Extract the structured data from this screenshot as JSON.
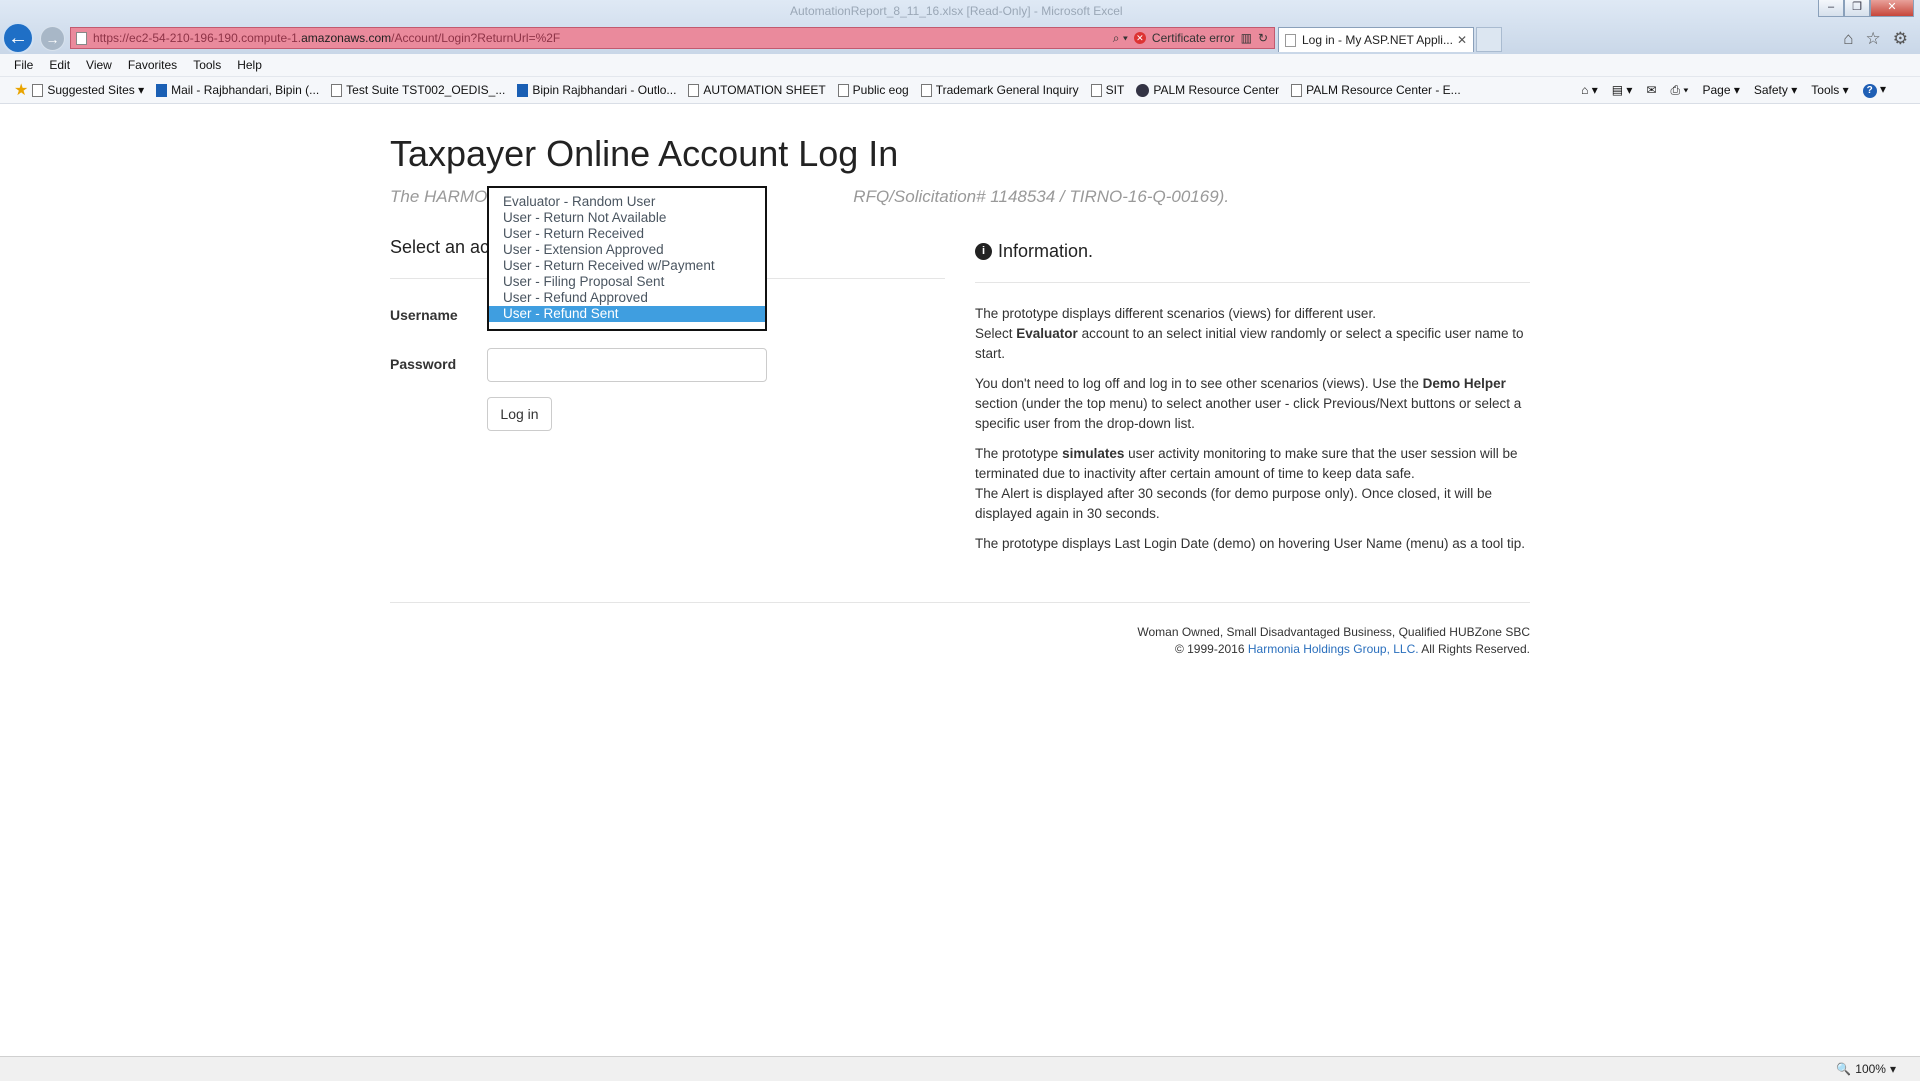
{
  "browser": {
    "window_title": "AutomationReport_8_11_16.xlsx [Read-Only] - Microsoft Excel",
    "url_prefix": "https://ec2-54-210-196-190.compute-1.",
    "url_domain": "amazonaws.com",
    "url_suffix": "/Account/Login?ReturnUrl=%2F",
    "certificate_error": "Certificate error",
    "tab_title": "Log in - My ASP.NET Appli...",
    "menu": [
      "File",
      "Edit",
      "View",
      "Favorites",
      "Tools",
      "Help"
    ],
    "favorites": [
      {
        "label": "Suggested Sites ▾",
        "icon": "page-icon"
      },
      {
        "label": "Mail - Rajbhandari, Bipin (...",
        "icon": "outlook-icon"
      },
      {
        "label": "Test Suite TST002_OEDIS_...",
        "icon": "page-icon"
      },
      {
        "label": "Bipin Rajbhandari - Outlo...",
        "icon": "outlook-icon"
      },
      {
        "label": "AUTOMATION SHEET",
        "icon": "page-icon"
      },
      {
        "label": "Public eog",
        "icon": "page-icon"
      },
      {
        "label": "Trademark General Inquiry",
        "icon": "page-icon"
      },
      {
        "label": "SIT",
        "icon": "page-icon"
      },
      {
        "label": "PALM Resource Center",
        "icon": "palm-icon"
      },
      {
        "label": "PALM Resource Center - E...",
        "icon": "page-icon"
      }
    ],
    "command_bar": {
      "page": "Page ▾",
      "safety": "Safety ▾",
      "tools": "Tools ▾"
    },
    "zoom": "100%"
  },
  "page": {
    "title": "Taxpayer Online Account Log In",
    "subtitle_left": "The HARMO",
    "subtitle_right": "RFQ/Solicitation# 1148534 / TIRNO-16-Q-00169).",
    "select_heading": "Select an ac",
    "username_label": "Username",
    "password_label": "Password",
    "login_button": "Log in",
    "dropdown_options": [
      "Evaluator - Random User",
      "User - Return Not Available",
      "User - Return Received",
      "User - Extension Approved",
      "User - Return Received w/Payment",
      "User - Filing Proposal Sent",
      "User - Refund Approved",
      "User - Refund Sent"
    ],
    "dropdown_selected": "User - Refund Sent"
  },
  "info": {
    "heading": "Information.",
    "p1_a": "The prototype displays different scenarios (views) for different user.",
    "p1_b": "Select ",
    "p1_bold": "Evaluator",
    "p1_c": " account to an select initial view randomly or select a specific user name to start.",
    "p2_a": "You don't need to log off and log in to see other scenarios (views). Use the ",
    "p2_bold": "Demo Helper",
    "p2_b": " section (under the top menu) to select another user - click Previous/Next buttons or select a specific user from the drop-down list.",
    "p3_a": "The prototype ",
    "p3_bold": "simulates",
    "p3_b": " user activity monitoring to make sure that the user session will be terminated due to inactivity after certain amount of time to keep data safe.",
    "p3_c": "The Alert is displayed after 30 seconds (for demo purpose only). Once closed, it will be displayed again in 30 seconds.",
    "p4": "The prototype displays Last Login Date (demo) on hovering User Name (menu) as a tool tip."
  },
  "footer": {
    "line1": "Woman Owned, Small Disadvantaged Business, Qualified HUBZone SBC",
    "copyright": "© 1999-2016 ",
    "company": "Harmonia Holdings Group, LLC.",
    "rights": " All Rights Reserved."
  }
}
